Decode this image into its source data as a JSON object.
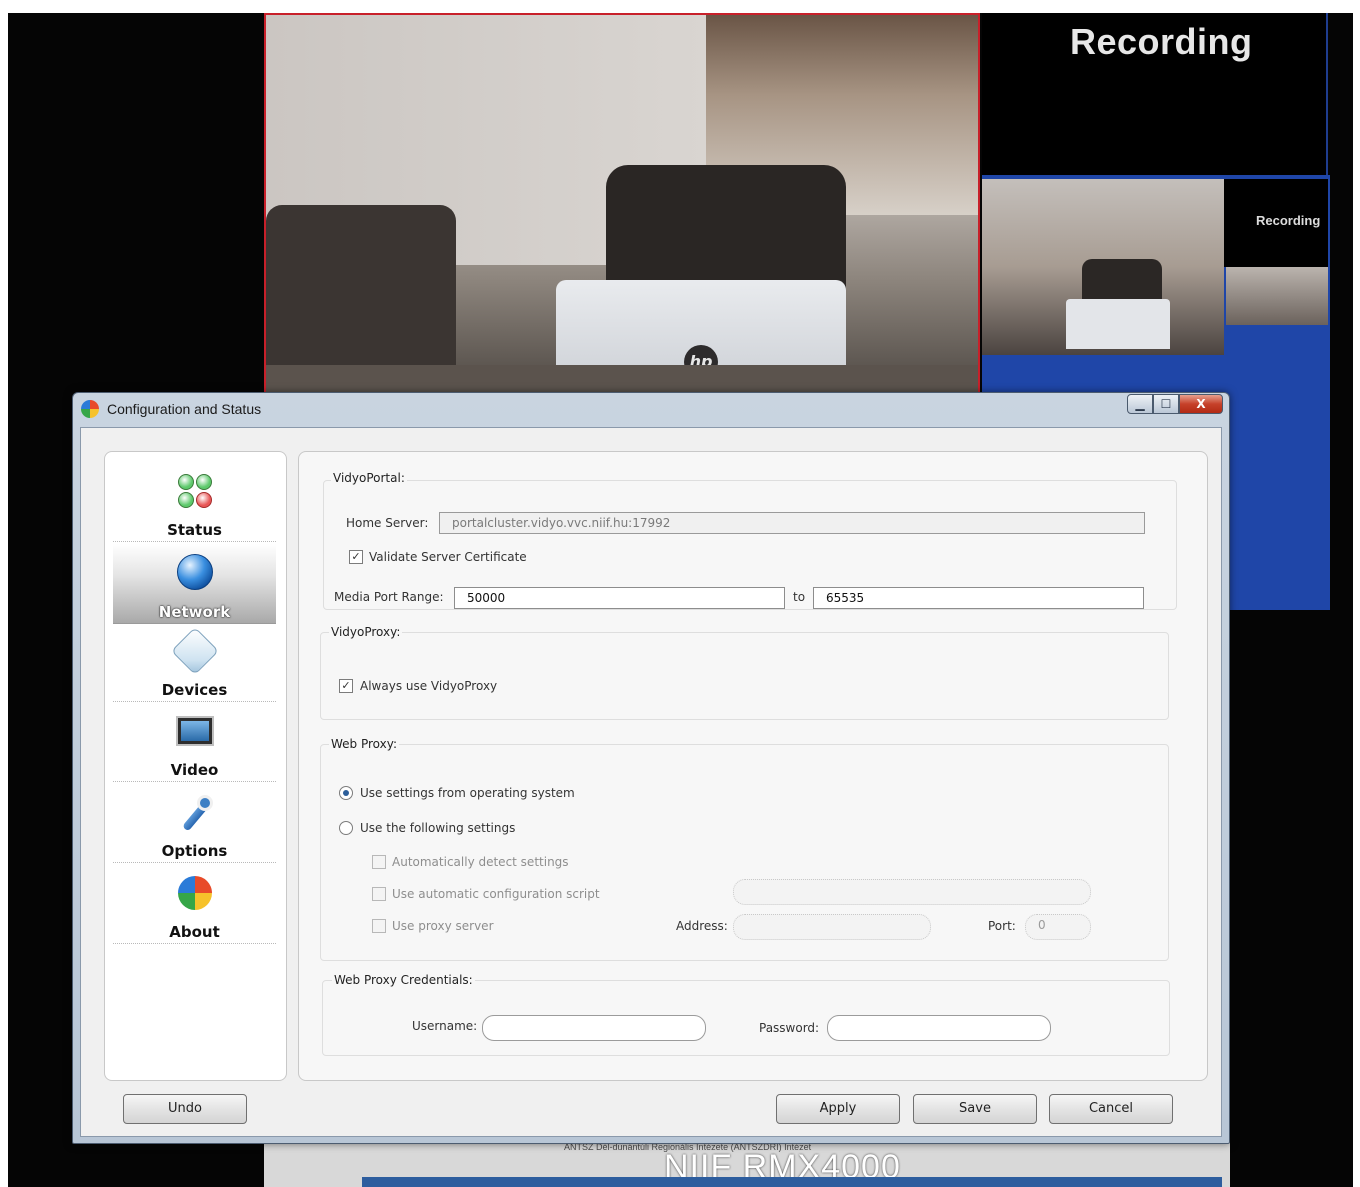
{
  "background": {
    "recording_label": "Recording",
    "pip_recording_label": "Recording",
    "bottom_label": "NIIF RMX4000",
    "bottom_small_text": "ANTSZ Dél-dunántúli Regionális Intézete (ÁNTSZDRI) Intézet",
    "colors": {
      "recording_blue": "#1f46a8",
      "active_speaker_border": "#c8202a"
    }
  },
  "window": {
    "title": "Configuration and Status",
    "controls": {
      "minimize": "▁",
      "maximize": "☐",
      "close": "X"
    }
  },
  "sidebar": {
    "items": [
      {
        "label": "Status",
        "icon": "status-lights-icon",
        "active": false
      },
      {
        "label": "Network",
        "icon": "globe-icon",
        "active": true
      },
      {
        "label": "Devices",
        "icon": "devices-icon",
        "active": false
      },
      {
        "label": "Video",
        "icon": "video-icon",
        "active": false
      },
      {
        "label": "Options",
        "icon": "wrench-icon",
        "active": false
      },
      {
        "label": "About",
        "icon": "about-icon",
        "active": false
      }
    ]
  },
  "vidyoportal": {
    "title": "VidyoPortal:",
    "home_server_label": "Home Server:",
    "home_server_value": "portalcluster.vidyo.vvc.niif.hu:17992",
    "validate_cert_label": "Validate Server Certificate",
    "validate_cert_checked": true,
    "media_port_label": "Media Port Range:",
    "media_port_from": "50000",
    "to_label": "to",
    "media_port_to": "65535"
  },
  "vidyoproxy": {
    "title": "VidyoProxy:",
    "always_use_label": "Always use VidyoProxy",
    "always_use_checked": true
  },
  "webproxy": {
    "title": "Web Proxy:",
    "use_os_label": "Use settings from operating system",
    "use_os_selected": true,
    "use_following_label": "Use the following settings",
    "auto_detect_label": "Automatically detect settings",
    "auto_config_label": "Use automatic configuration script",
    "auto_config_value": "",
    "use_proxy_label": "Use proxy server",
    "address_label": "Address:",
    "address_value": "",
    "port_label": "Port:",
    "port_value": "0"
  },
  "credentials": {
    "title": "Web Proxy Credentials:",
    "username_label": "Username:",
    "username_value": "",
    "password_label": "Password:",
    "password_value": ""
  },
  "buttons": {
    "undo": "Undo",
    "apply": "Apply",
    "save": "Save",
    "cancel": "Cancel"
  }
}
